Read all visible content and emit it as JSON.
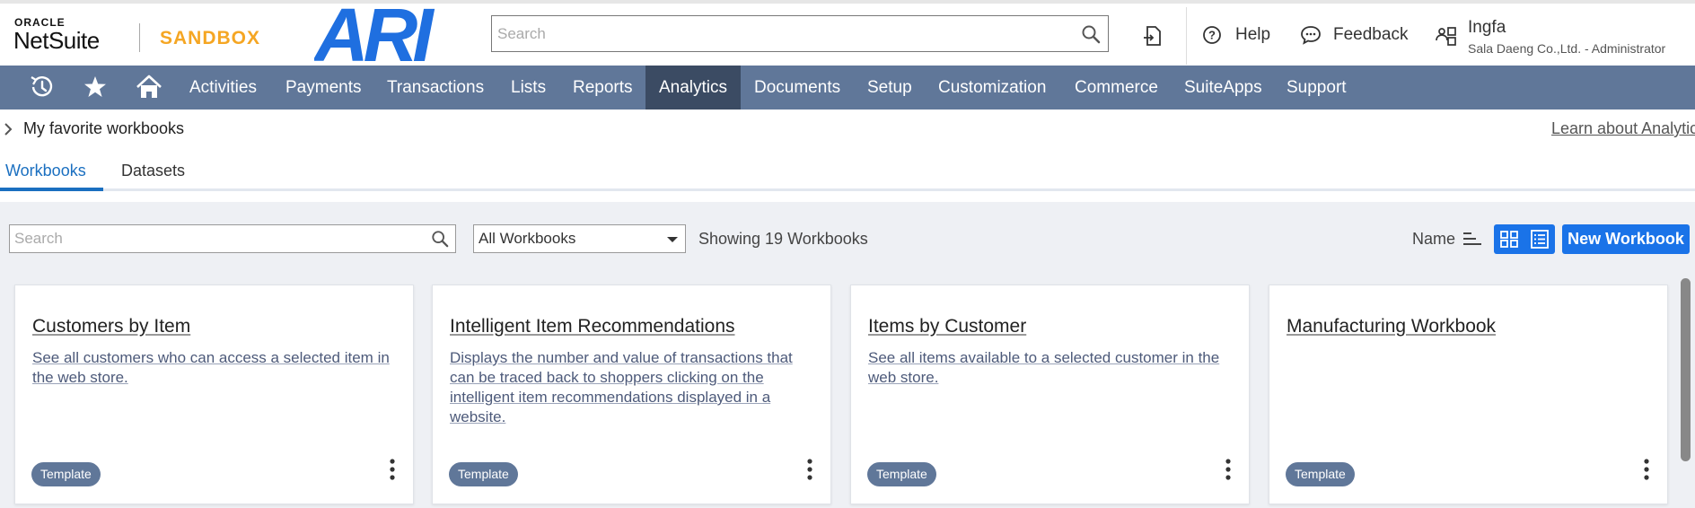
{
  "header": {
    "oracle_label": "ORACLE",
    "netsuite_label": "NetSuite",
    "sandbox_label": "SANDBOX",
    "brand_logo_text": "ARI",
    "search_placeholder": "Search",
    "help_label": "Help",
    "feedback_label": "Feedback",
    "user_name": "Ingfa",
    "user_role": "Sala Daeng Co.,Ltd. - Administrator"
  },
  "nav": {
    "items": [
      "Activities",
      "Payments",
      "Transactions",
      "Lists",
      "Reports",
      "Analytics",
      "Documents",
      "Setup",
      "Customization",
      "Commerce",
      "SuiteApps",
      "Support"
    ],
    "active": "Analytics"
  },
  "favorites": {
    "label": "My favorite workbooks",
    "learn_link": "Learn about Analytics"
  },
  "tabs": [
    "Workbooks",
    "Datasets"
  ],
  "toolbar": {
    "search_placeholder": "Search",
    "filter_value": "All Workbooks",
    "showing_text": "Showing 19 Workbooks",
    "sort_label": "Name",
    "new_button": "New Workbook"
  },
  "cards": [
    {
      "title": "Customers by Item",
      "description": "See all customers who can access a selected item in the web store.",
      "badge": "Template"
    },
    {
      "title": "Intelligent Item Recommendations",
      "description": "Displays the number and value of transactions that can be traced back to shoppers clicking on the intelligent item recommendations displayed in a website.",
      "badge": "Template"
    },
    {
      "title": "Items by Customer",
      "description": "See all items available to a selected customer in the web store.",
      "badge": "Template"
    },
    {
      "title": "Manufacturing Workbook",
      "description": "",
      "badge": "Template"
    }
  ],
  "colors": {
    "nav_bg": "#607799",
    "nav_active": "#3b4b63",
    "accent": "#1a73e8",
    "sandbox": "#f5a623",
    "brand": "#1f6fe0"
  }
}
